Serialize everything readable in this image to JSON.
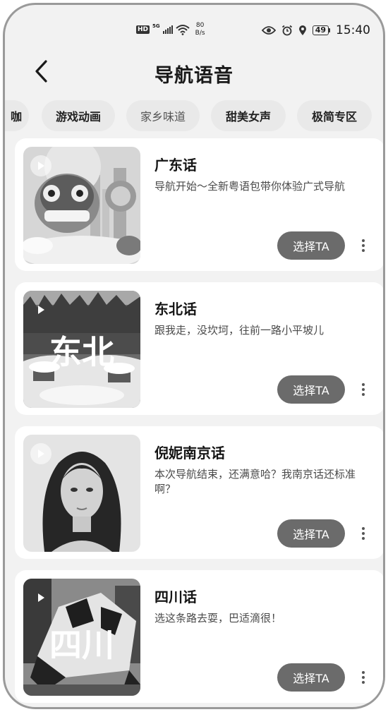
{
  "status_bar": {
    "hd": "HD",
    "network": "5G",
    "speed_value": "80",
    "speed_unit": "B/s",
    "battery": "49",
    "time": "15:40"
  },
  "header": {
    "title": "导航语音"
  },
  "tabs": [
    {
      "label": "咖"
    },
    {
      "label": "游戏动画"
    },
    {
      "label": "家乡味道"
    },
    {
      "label": "甜美女声"
    },
    {
      "label": "极简专区"
    }
  ],
  "voices": [
    {
      "title": "广东话",
      "desc": "导航开始～全新粤语包带你体验广式导航",
      "button": "选择TA",
      "cover": "lion-dance-illustration"
    },
    {
      "title": "东北话",
      "desc": "跟我走，没坎坷，往前一路小平坡儿",
      "button": "选择TA",
      "cover": "snow-village-photo",
      "cover_text": "东北"
    },
    {
      "title": "倪妮南京话",
      "desc": "本次导航结束，还满意哈？我南京话还标准啊？",
      "button": "选择TA",
      "cover": "portrait-photo"
    },
    {
      "title": "四川话",
      "desc": "选这条路去耍，巴适滴很！",
      "button": "选择TA",
      "cover": "panda-sculpture-photo",
      "cover_text": "四川"
    }
  ]
}
